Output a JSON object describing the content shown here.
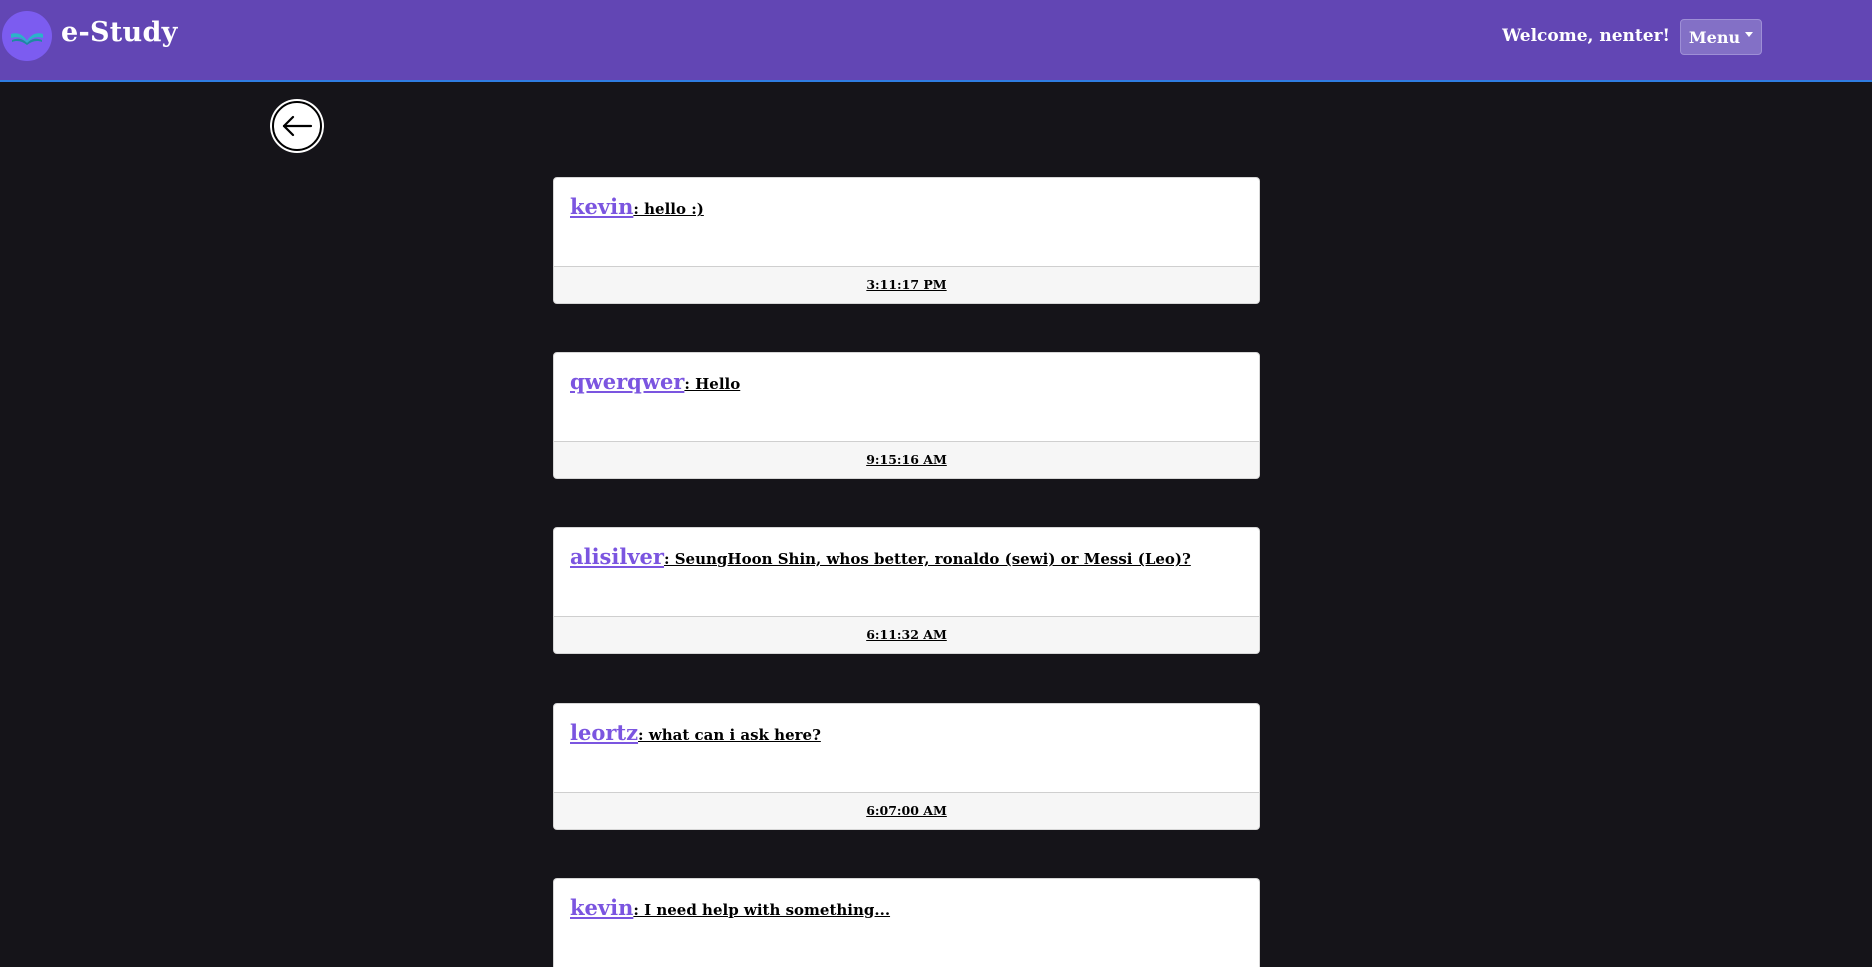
{
  "navbar": {
    "brand": "e-Study",
    "brand_logo_icon": "book-logo-icon",
    "welcome": "Welcome, nenter!",
    "menu_label": "Menu",
    "colors": {
      "navbar": "#6246b4",
      "accent_border": "#2f7de1",
      "username": "#7b55e0",
      "background": "#151419"
    }
  },
  "back_button": {
    "icon": "arrow-left-icon"
  },
  "messages": [
    {
      "user": "kevin",
      "text": ": hello :)",
      "time": "3:11:17 PM"
    },
    {
      "user": "qwerqwer",
      "text": ": Hello",
      "time": "9:15:16 AM"
    },
    {
      "user": "alisilver",
      "text": ": SeungHoon Shin, whos better, ronaldo (sewi) or Messi (Leo)?",
      "time": "6:11:32 AM"
    },
    {
      "user": "leortz",
      "text": ": what can i ask here?",
      "time": "6:07:00 AM"
    },
    {
      "user": "kevin",
      "text": ": I need help with something...",
      "time": ""
    }
  ]
}
